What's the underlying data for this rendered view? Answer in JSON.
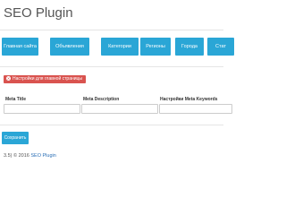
{
  "header": {
    "title": "SEO Plugin"
  },
  "tabs": [
    {
      "label": "Главная сайта"
    },
    {
      "label": "Объявления"
    },
    {
      "label": "Категории"
    },
    {
      "label": "Регионы"
    },
    {
      "label": "Города"
    },
    {
      "label": "Стат"
    }
  ],
  "alert": {
    "text": "Настройки для главной страницы"
  },
  "form": {
    "columns": [
      {
        "label": "Meta Title",
        "value": ""
      },
      {
        "label": "Meta Description",
        "value": ""
      },
      {
        "label": "Настройки Meta Keywords",
        "value": ""
      }
    ],
    "save_label": "Сохранить"
  },
  "footer": {
    "prefix": "3.5) © 2016 ",
    "link": "SEO Plugin"
  },
  "colors": {
    "accent": "#2aa6d6",
    "alert": "#d9534f",
    "link": "#2a6fb6"
  }
}
